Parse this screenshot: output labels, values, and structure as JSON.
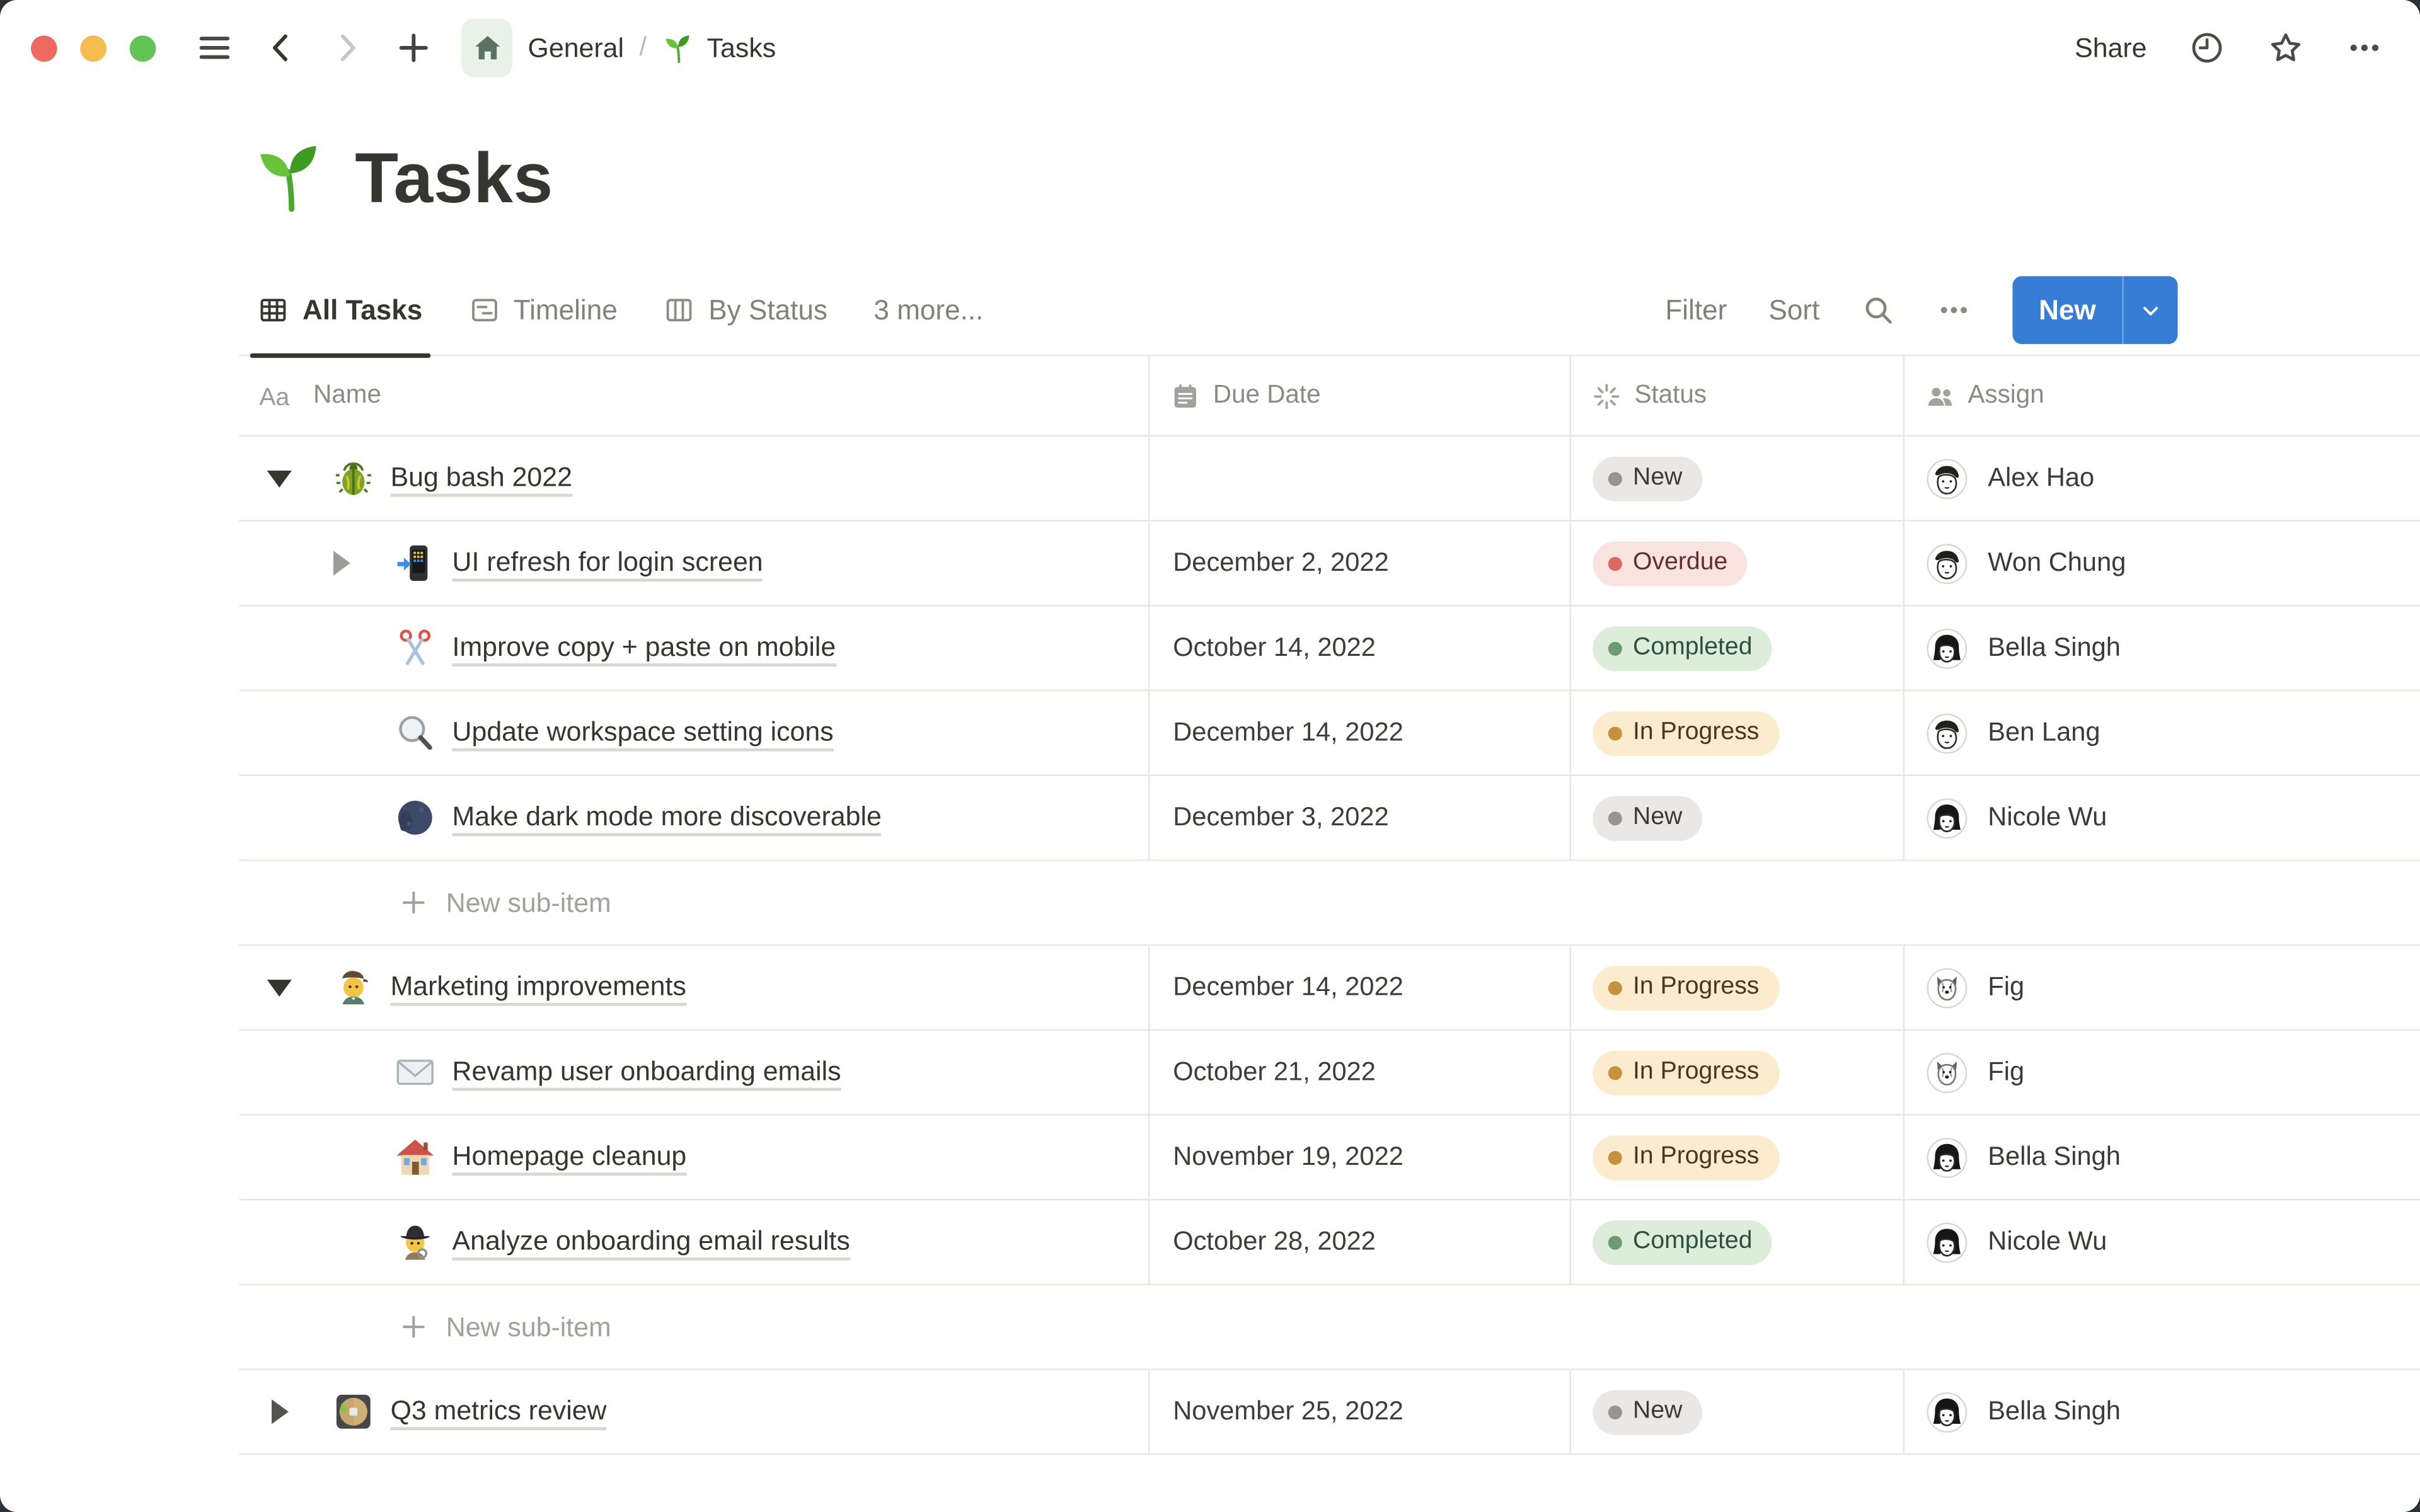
{
  "titlebar": {
    "breadcrumb": {
      "workspace": "General",
      "separator": "/",
      "page": "Tasks"
    },
    "share_label": "Share"
  },
  "page": {
    "emoji": "seedling",
    "title": "Tasks"
  },
  "views": {
    "tabs": [
      {
        "label": "All Tasks",
        "icon": "table-view-icon",
        "active": true
      },
      {
        "label": "Timeline",
        "icon": "timeline-view-icon",
        "active": false
      },
      {
        "label": "By Status",
        "icon": "board-view-icon",
        "active": false
      },
      {
        "label": "3 more...",
        "icon": null,
        "active": false
      }
    ],
    "controls": {
      "filter_label": "Filter",
      "sort_label": "Sort",
      "search_icon": "magnifier",
      "more_icon": "ellipsis",
      "new_button": {
        "label": "New",
        "color": "#377dd5"
      }
    }
  },
  "table": {
    "columns": [
      {
        "label": "Name",
        "icon": "text-icon"
      },
      {
        "label": "Due Date",
        "icon": "calendar-icon"
      },
      {
        "label": "Status",
        "icon": "status-icon"
      },
      {
        "label": "Assign",
        "icon": "people-icon"
      }
    ],
    "new_sub_item_label": "New sub-item",
    "rows": [
      {
        "type": "task",
        "indent": 0,
        "toggle": "down-dark",
        "icon": "beetle",
        "name": "Bug bash 2022",
        "due": "",
        "status": "New",
        "assignee": "Alex Hao",
        "avatar": "man"
      },
      {
        "type": "task",
        "indent": 1,
        "toggle": "right-gray",
        "icon": "phone-arrow",
        "name": "UI refresh for login screen",
        "due": "December 2, 2022",
        "status": "Overdue",
        "assignee": "Won Chung",
        "avatar": "man"
      },
      {
        "type": "task",
        "indent": 1,
        "toggle": null,
        "icon": "scissors",
        "name": "Improve copy + paste on mobile",
        "due": "October 14, 2022",
        "status": "Completed",
        "assignee": "Bella Singh",
        "avatar": "woman"
      },
      {
        "type": "task",
        "indent": 1,
        "toggle": null,
        "icon": "magnifier",
        "name": "Update workspace setting icons",
        "due": "December 14, 2022",
        "status": "In Progress",
        "assignee": "Ben Lang",
        "avatar": "man"
      },
      {
        "type": "task",
        "indent": 1,
        "toggle": null,
        "icon": "moon",
        "name": "Make dark mode more discoverable",
        "due": "December 3, 2022",
        "status": "New",
        "assignee": "Nicole Wu",
        "avatar": "woman"
      },
      {
        "type": "new-sub-item"
      },
      {
        "type": "task",
        "indent": 0,
        "toggle": "down-dark",
        "icon": "artist",
        "name": "Marketing improvements",
        "due": "December 14, 2022",
        "status": "In Progress",
        "assignee": "Fig",
        "avatar": "dog"
      },
      {
        "type": "task",
        "indent": 1,
        "toggle": null,
        "icon": "envelope",
        "name": "Revamp user onboarding emails",
        "due": "October 21, 2022",
        "status": "In Progress",
        "assignee": "Fig",
        "avatar": "dog"
      },
      {
        "type": "task",
        "indent": 1,
        "toggle": null,
        "icon": "house",
        "name": "Homepage cleanup",
        "due": "November 19, 2022",
        "status": "In Progress",
        "assignee": "Bella Singh",
        "avatar": "woman"
      },
      {
        "type": "task",
        "indent": 1,
        "toggle": null,
        "icon": "detective",
        "name": "Analyze onboarding email results",
        "due": "October 28, 2022",
        "status": "Completed",
        "assignee": "Nicole Wu",
        "avatar": "woman"
      },
      {
        "type": "new-sub-item"
      },
      {
        "type": "task",
        "indent": 0,
        "toggle": "right-dark",
        "icon": "disc",
        "name": "Q3 metrics review",
        "due": "November 25, 2022",
        "status": "New",
        "assignee": "Bella Singh",
        "avatar": "woman"
      }
    ]
  },
  "status_variants": {
    "New": "gray",
    "Overdue": "red",
    "Completed": "green",
    "In Progress": "yellow"
  },
  "status_colors": {
    "gray": {
      "bg": "#e9e8e6",
      "dot": "#979592",
      "text": "#3c3a36"
    },
    "red": {
      "bg": "#f9e3e1",
      "dot": "#db6960",
      "text": "#632f28"
    },
    "green": {
      "bg": "#dcedda",
      "dot": "#6b9a73",
      "text": "#2d4f3d"
    },
    "yellow": {
      "bg": "#fbeccd",
      "dot": "#c5913c",
      "text": "#4e3519"
    }
  },
  "window_colors": {
    "close": "#ee6a5f",
    "minimize": "#f5bd4f",
    "zoom": "#61c454",
    "accent_blue": "#377dd5",
    "divider": "#e7e6e3",
    "text_dark": "#37352f",
    "text_gray": "#83817c"
  }
}
